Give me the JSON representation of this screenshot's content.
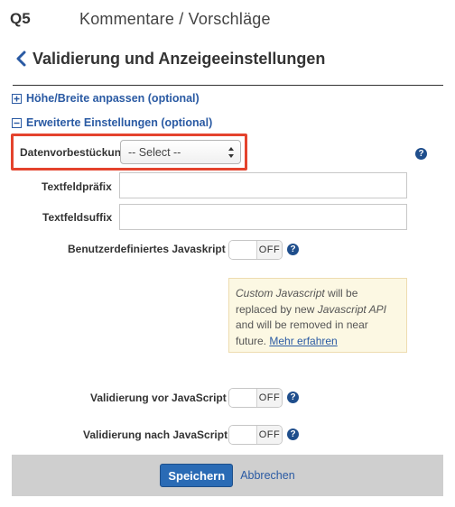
{
  "header": {
    "question_label": "Q5",
    "breadcrumb": "Kommentare / Vorschläge"
  },
  "page": {
    "title": "Validierung und Anzeigeeinstellungen"
  },
  "sections": {
    "size": {
      "label": "Höhe/Breite anpassen (optional)",
      "expanded": false
    },
    "advanced": {
      "label": "Erweiterte Einstellungen (optional)",
      "expanded": true
    }
  },
  "fields": {
    "prefill": {
      "label": "Datenvorbestückung",
      "selected": "-- Select --"
    },
    "prefix": {
      "label": "Textfeldpräfix",
      "value": ""
    },
    "suffix": {
      "label": "Textfeldsuffix",
      "value": ""
    },
    "custom_js": {
      "label": "Benutzerdefiniertes Javaskript",
      "state": "OFF"
    },
    "validate_before": {
      "label": "Validierung vor JavaScript",
      "state": "OFF"
    },
    "validate_after": {
      "label": "Validierung nach JavaScript",
      "state": "OFF"
    }
  },
  "notice": {
    "part1": "Custom Javascript",
    "part2": " will be replaced by new ",
    "part3": "Javascript API",
    "part4": " and will be removed in near future. ",
    "link": "Mehr erfahren"
  },
  "footer": {
    "save_label": "Speichern",
    "cancel_label": "Abbrechen"
  },
  "colors": {
    "accent": "#2a5aa3",
    "highlight": "#e4432d",
    "primary_button": "#2a6bb5"
  }
}
